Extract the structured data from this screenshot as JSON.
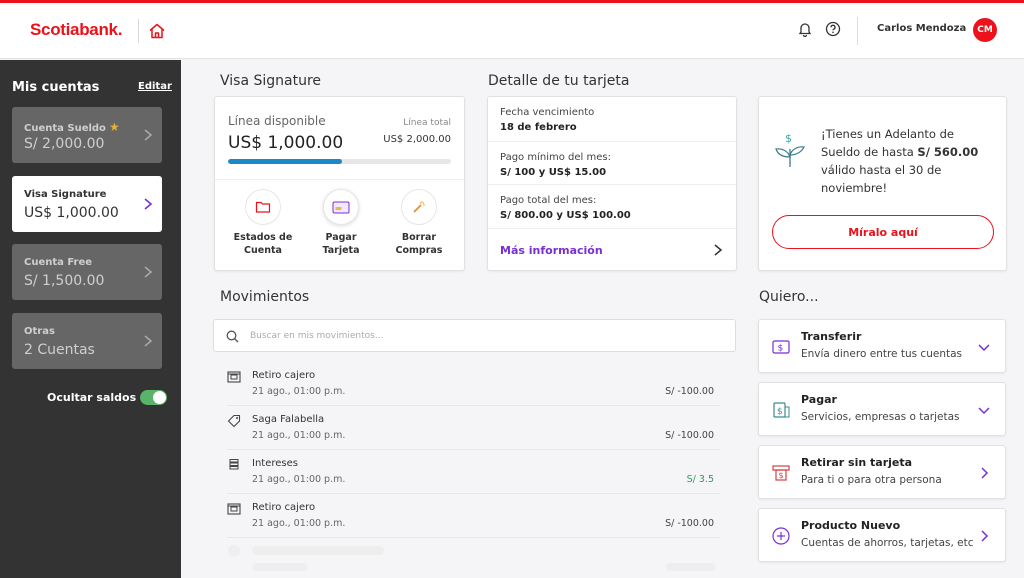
{
  "header": {
    "logo": "Scotiabank.",
    "user_name": "Carlos Mendoza",
    "avatar_initials": "CM"
  },
  "sidebar": {
    "title": "Mis cuentas",
    "edit_label": "Editar",
    "accounts": [
      {
        "name": "Cuenta Sueldo",
        "value": "S/ 2,000.00",
        "starred": true
      },
      {
        "name": "Visa Signature",
        "value": "US$ 1,000.00",
        "active": true
      },
      {
        "name": "Cuenta Free",
        "value": "S/ 1,500.00"
      },
      {
        "name": "Otras",
        "value": "2 Cuentas"
      }
    ],
    "hide_balances_label": "Ocultar saldos",
    "hide_balances_on": true
  },
  "visa": {
    "section_title": "Visa Signature",
    "available_label": "Línea disponible",
    "available_amount": "US$ 1,000.00",
    "total_label": "Línea total",
    "total_amount": "US$ 2,000.00",
    "usage_fraction": 0.51,
    "actions": [
      {
        "label1": "Estados de",
        "label2": "Cuenta"
      },
      {
        "label1": "Pagar",
        "label2": "Tarjeta"
      },
      {
        "label1": "Borrar",
        "label2": "Compras"
      }
    ]
  },
  "detail": {
    "section_title": "Detalle de tu tarjeta",
    "rows": [
      {
        "label": "Fecha vencimiento",
        "value": "18 de febrero"
      },
      {
        "label": "Pago mínimo del mes:",
        "value": "S/ 100 y US$ 15.00"
      },
      {
        "label": "Pago total del mes:",
        "value": "S/ 800.00 y US$ 100.00"
      }
    ],
    "more_label": "Más información"
  },
  "promo": {
    "text_before": "¡Tienes un Adelanto de Sueldo de hasta ",
    "text_amount": "S/ 560.00",
    "text_after": " válido hasta el 30 de noviembre!",
    "button_label": "Míralo aquí"
  },
  "movements": {
    "section_title": "Movimientos",
    "search_placeholder": "Buscar en mis movimientos...",
    "items": [
      {
        "title": "Retiro cajero",
        "date": "21 ago., 01:00 p.m.",
        "amount": "S/ -100.00",
        "icon": "atm-icon"
      },
      {
        "title": "Saga Falabella",
        "date": "21 ago., 01:00 p.m.",
        "amount": "S/ -100.00",
        "icon": "tag-icon"
      },
      {
        "title": "Intereses",
        "date": "21 ago., 01:00 p.m.",
        "amount": "S/ 3.5",
        "icon": "coins-icon"
      },
      {
        "title": "Retiro cajero",
        "date": "21 ago., 01:00 p.m.",
        "amount": "S/ -100.00",
        "icon": "atm-icon"
      }
    ]
  },
  "quiero": {
    "section_title": "Quiero...",
    "items": [
      {
        "title": "Transferir",
        "subtitle": "Envía dinero entre tus cuentas",
        "icon": "transfer-icon"
      },
      {
        "title": "Pagar",
        "subtitle": "Servicios, empresas o tarjetas",
        "icon": "pay-icon"
      },
      {
        "title": "Retirar sin tarjeta",
        "subtitle": "Para ti o para otra persona",
        "icon": "cash-withdraw-icon"
      },
      {
        "title": "Producto Nuevo",
        "subtitle": "Cuentas de ahorros, tarjetas, etc",
        "icon": "plus-circle-icon"
      }
    ]
  },
  "colors": {
    "brand_red": "#ec111a",
    "accent_purple": "#7a2fd1",
    "progress_blue": "#1e88c7",
    "positive_green": "#2e9e58",
    "sidebar_bg": "#333333"
  }
}
